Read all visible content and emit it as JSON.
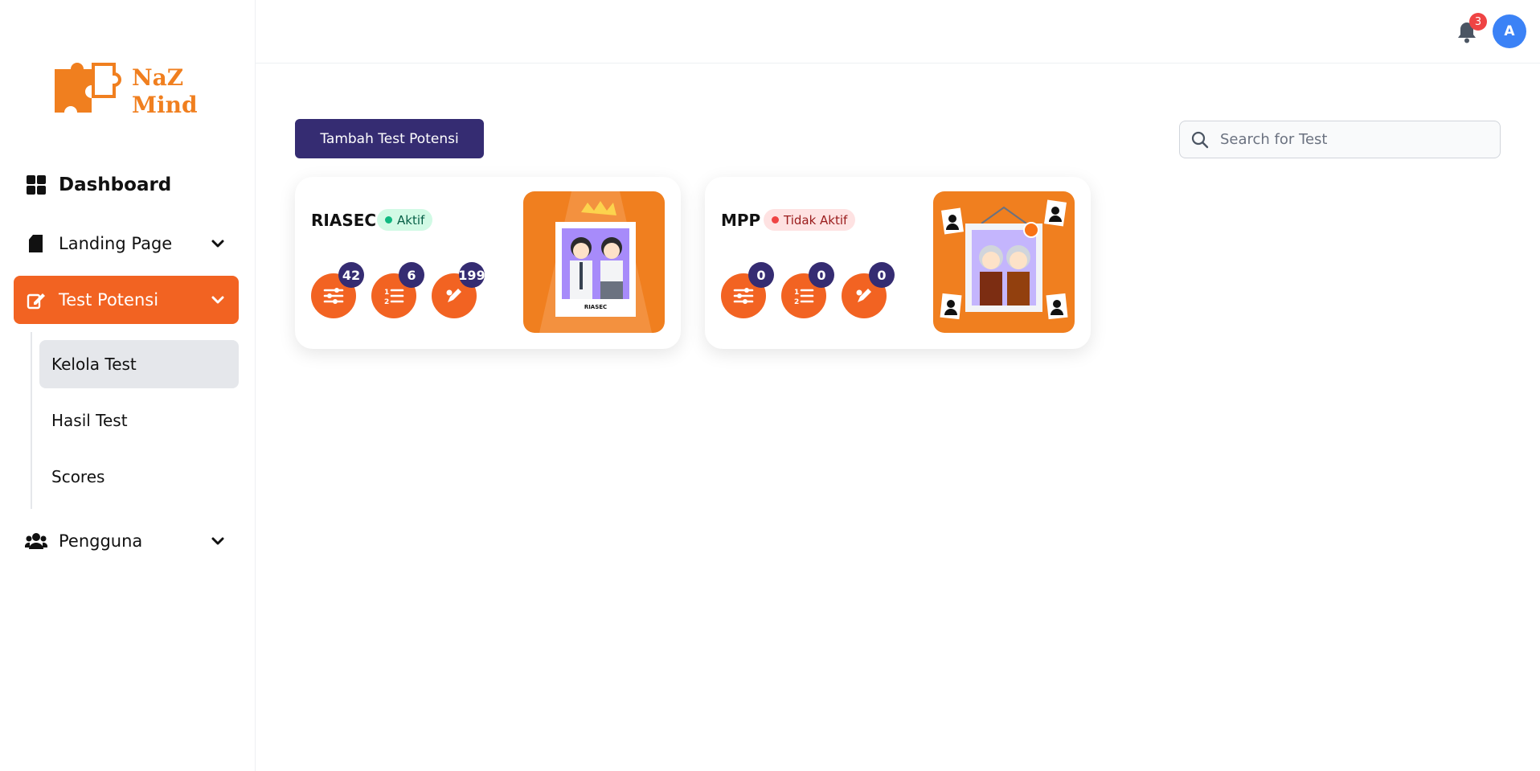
{
  "logo": {
    "line1": "NaZ",
    "line2": "Mind"
  },
  "sidebar": {
    "dashboard": "Dashboard",
    "landing_page": "Landing Page",
    "test_potensi": "Test Potensi",
    "sub_items": [
      "Kelola Test",
      "Hasil Test",
      "Scores"
    ],
    "pengguna": "Pengguna"
  },
  "topbar": {
    "notification_count": "3",
    "avatar_initial": "A"
  },
  "main": {
    "add_button": "Tambah Test Potensi",
    "search_placeholder": "Search for Test",
    "cards": [
      {
        "title": "RIASEC",
        "status": "Aktif",
        "counts": [
          "42",
          "6",
          "199"
        ],
        "thumb_caption": "RIASEC"
      },
      {
        "title": "MPP",
        "status": "Tidak Aktif",
        "counts": [
          "0",
          "0",
          "0"
        ]
      }
    ]
  },
  "colors": {
    "accent": "#f26322",
    "primary": "#352c72",
    "active_bg": "#d1fae5",
    "inactive_bg": "#fee2e2",
    "avatar": "#3b82f6"
  },
  "icons": [
    "dashboard-icon",
    "document-icon",
    "edit-icon",
    "users-icon",
    "chevron-down-icon",
    "bell-icon",
    "search-icon",
    "sliders-icon",
    "ordered-list-icon",
    "pencil-icon"
  ]
}
